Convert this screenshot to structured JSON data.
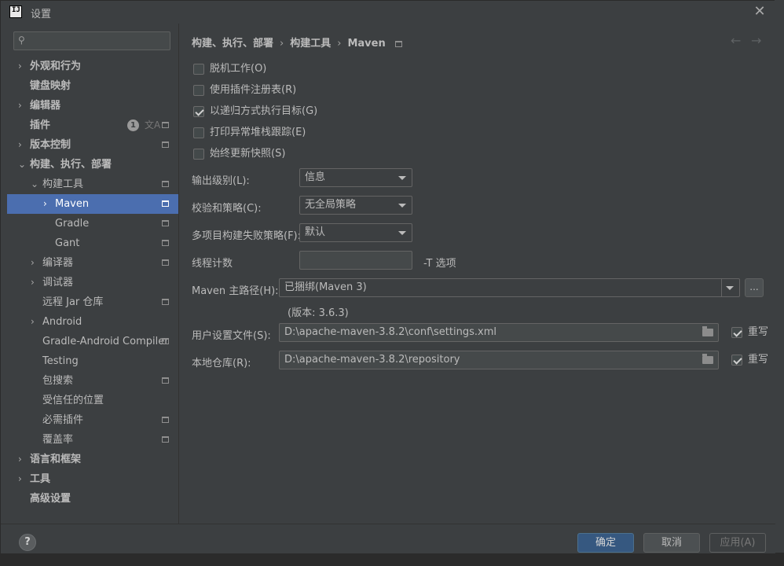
{
  "window": {
    "title": "设置",
    "app_icon_text": "IJ",
    "close_symbol": "✕"
  },
  "search": {
    "placeholder": "",
    "icon": "search-icon"
  },
  "sidebar": {
    "items": [
      {
        "label": "外观和行为",
        "arrow": "›"
      },
      {
        "label": "键盘映射"
      },
      {
        "label": "编辑器",
        "arrow": "›"
      },
      {
        "label": "插件",
        "badge": "1"
      },
      {
        "label": "版本控制",
        "arrow": "›"
      },
      {
        "label": "构建、执行、部署",
        "arrow": "⌄"
      },
      {
        "label": "构建工具",
        "arrow": "⌄"
      },
      {
        "label": "Maven",
        "arrow": "›",
        "selected": true
      },
      {
        "label": "Gradle"
      },
      {
        "label": "Gant"
      },
      {
        "label": "编译器",
        "arrow": "›"
      },
      {
        "label": "调试器",
        "arrow": "›"
      },
      {
        "label": "远程 Jar 仓库"
      },
      {
        "label": "Android",
        "arrow": "›"
      },
      {
        "label": "Gradle-Android Compiler"
      },
      {
        "label": "Testing"
      },
      {
        "label": "包搜索"
      },
      {
        "label": "受信任的位置"
      },
      {
        "label": "必需插件"
      },
      {
        "label": "覆盖率"
      },
      {
        "label": "语言和框架",
        "arrow": "›"
      },
      {
        "label": "工具",
        "arrow": "›"
      },
      {
        "label": "高级设置"
      }
    ],
    "lang_icon": "文A"
  },
  "breadcrumb": {
    "parts": [
      "构建、执行、部署",
      "构建工具",
      "Maven"
    ],
    "sep": "›",
    "back": "←",
    "forward": "→"
  },
  "checkboxes": [
    {
      "label": "脱机工作(O)",
      "checked": false
    },
    {
      "label": "使用插件注册表(R)",
      "checked": false
    },
    {
      "label": "以递归方式执行目标(G)",
      "checked": true
    },
    {
      "label": "打印异常堆栈跟踪(E)",
      "checked": false
    },
    {
      "label": "始终更新快照(S)",
      "checked": false
    }
  ],
  "form": {
    "output_level_label": "输出级别(L):",
    "output_level_value": "信息",
    "checksum_label": "校验和策略(C):",
    "checksum_value": "无全局策略",
    "fail_policy_label": "多项目构建失败策略(F):",
    "fail_policy_value": "默认",
    "thread_count_label": "线程计数",
    "thread_count_value": "",
    "thread_count_suffix": "-T 选项",
    "maven_home_label": "Maven 主路径(H):",
    "maven_home_value": "已捆绑(Maven 3)",
    "maven_home_button": "...",
    "version_text": "(版本: 3.6.3)",
    "user_settings_label": "用户设置文件(S):",
    "user_settings_value": "D:\\apache-maven-3.8.2\\conf\\settings.xml",
    "user_settings_override": "重写",
    "local_repo_label": "本地仓库(R):",
    "local_repo_value": "D:\\apache-maven-3.8.2\\repository",
    "local_repo_override": "重写"
  },
  "footer": {
    "help": "?",
    "ok": "确定",
    "cancel": "取消",
    "apply": "应用(A)"
  }
}
